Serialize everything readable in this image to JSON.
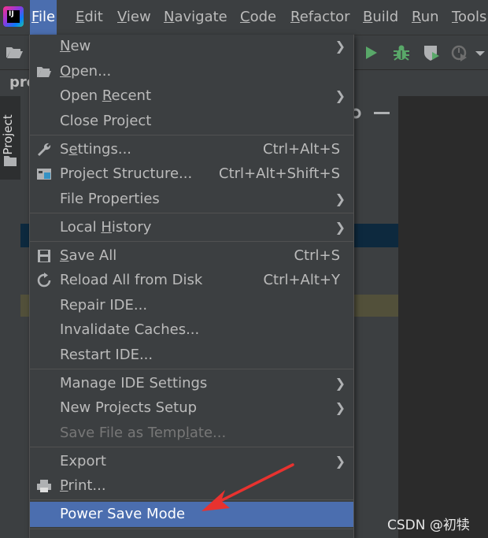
{
  "menubar": {
    "items": [
      {
        "label": "File",
        "mnemonic": "F",
        "rest": "ile",
        "active": true
      },
      {
        "label": "Edit",
        "mnemonic": "E",
        "rest": "dit"
      },
      {
        "label": "View",
        "mnemonic": "V",
        "rest": "iew"
      },
      {
        "label": "Navigate",
        "mnemonic": "N",
        "rest": "avigate"
      },
      {
        "label": "Code",
        "mnemonic": "C",
        "rest": "ode"
      },
      {
        "label": "Refactor",
        "mnemonic": "R",
        "rest": "efactor"
      },
      {
        "label": "Build",
        "mnemonic": "B",
        "rest": "uild"
      },
      {
        "label": "Run",
        "mnemonic": "R",
        "rest": "un"
      },
      {
        "label": "Tools",
        "mnemonic": "T",
        "rest": "ools"
      }
    ]
  },
  "logo": {
    "text": "IJ",
    "icon": "intellij-logo-icon"
  },
  "navrow": {
    "crumb": "pro"
  },
  "toolstrip": {
    "project_label": "Project"
  },
  "file_menu": {
    "items": [
      {
        "id": "new",
        "pre": "",
        "mn": "N",
        "post": "ew",
        "shortcut": "",
        "submenu": true,
        "icon": ""
      },
      {
        "id": "open",
        "pre": "",
        "mn": "O",
        "post": "pen...",
        "shortcut": "",
        "submenu": false,
        "icon": "folder-icon"
      },
      {
        "id": "open-recent",
        "pre": "Open ",
        "mn": "R",
        "post": "ecent",
        "shortcut": "",
        "submenu": true,
        "icon": ""
      },
      {
        "id": "close-project",
        "pre": "Close Project",
        "mn": "",
        "post": "",
        "shortcut": "",
        "submenu": false,
        "icon": ""
      },
      {
        "id": "settings",
        "pre": "S",
        "mn": "e",
        "post": "ttings...",
        "shortcut": "Ctrl+Alt+S",
        "submenu": false,
        "icon": "wrench-icon"
      },
      {
        "id": "project-structure",
        "pre": "Project Structure...",
        "mn": "",
        "post": "",
        "shortcut": "Ctrl+Alt+Shift+S",
        "submenu": false,
        "icon": "project-structure-icon"
      },
      {
        "id": "file-properties",
        "pre": "File Properties",
        "mn": "",
        "post": "",
        "shortcut": "",
        "submenu": true,
        "icon": ""
      },
      {
        "id": "local-history",
        "pre": "Local ",
        "mn": "H",
        "post": "istory",
        "shortcut": "",
        "submenu": true,
        "icon": ""
      },
      {
        "id": "save-all",
        "pre": "",
        "mn": "S",
        "post": "ave All",
        "shortcut": "Ctrl+S",
        "submenu": false,
        "icon": "save-icon"
      },
      {
        "id": "reload-all",
        "pre": "Reload All from Disk",
        "mn": "",
        "post": "",
        "shortcut": "Ctrl+Alt+Y",
        "submenu": false,
        "icon": "reload-icon"
      },
      {
        "id": "repair-ide",
        "pre": "Repair IDE...",
        "mn": "",
        "post": "",
        "shortcut": "",
        "submenu": false,
        "icon": ""
      },
      {
        "id": "invalidate-caches",
        "pre": "Invalidate Caches...",
        "mn": "",
        "post": "",
        "shortcut": "",
        "submenu": false,
        "icon": ""
      },
      {
        "id": "restart-ide",
        "pre": "Restart IDE...",
        "mn": "",
        "post": "",
        "shortcut": "",
        "submenu": false,
        "icon": ""
      },
      {
        "id": "manage-ide-settings",
        "pre": "Manage IDE Settings",
        "mn": "",
        "post": "",
        "shortcut": "",
        "submenu": true,
        "icon": ""
      },
      {
        "id": "new-projects-setup",
        "pre": "New Projects Setup",
        "mn": "",
        "post": "",
        "shortcut": "",
        "submenu": true,
        "icon": ""
      },
      {
        "id": "save-file-as-template",
        "pre": "Save File as Temp",
        "mn": "l",
        "post": "ate...",
        "shortcut": "",
        "submenu": false,
        "icon": "",
        "disabled": true
      },
      {
        "id": "export",
        "pre": "Export",
        "mn": "",
        "post": "",
        "shortcut": "",
        "submenu": true,
        "icon": ""
      },
      {
        "id": "print",
        "pre": "",
        "mn": "P",
        "post": "rint...",
        "shortcut": "",
        "submenu": false,
        "icon": "print-icon"
      },
      {
        "id": "power-save-mode",
        "pre": "Power Save Mode",
        "mn": "",
        "post": "",
        "shortcut": "",
        "submenu": false,
        "icon": "",
        "selected": true
      }
    ]
  },
  "colors": {
    "menu_bg": "#3c3f41",
    "selection": "#4b6eaf",
    "annotation_arrow": "#e8322f"
  },
  "watermark": "CSDN @初犊"
}
